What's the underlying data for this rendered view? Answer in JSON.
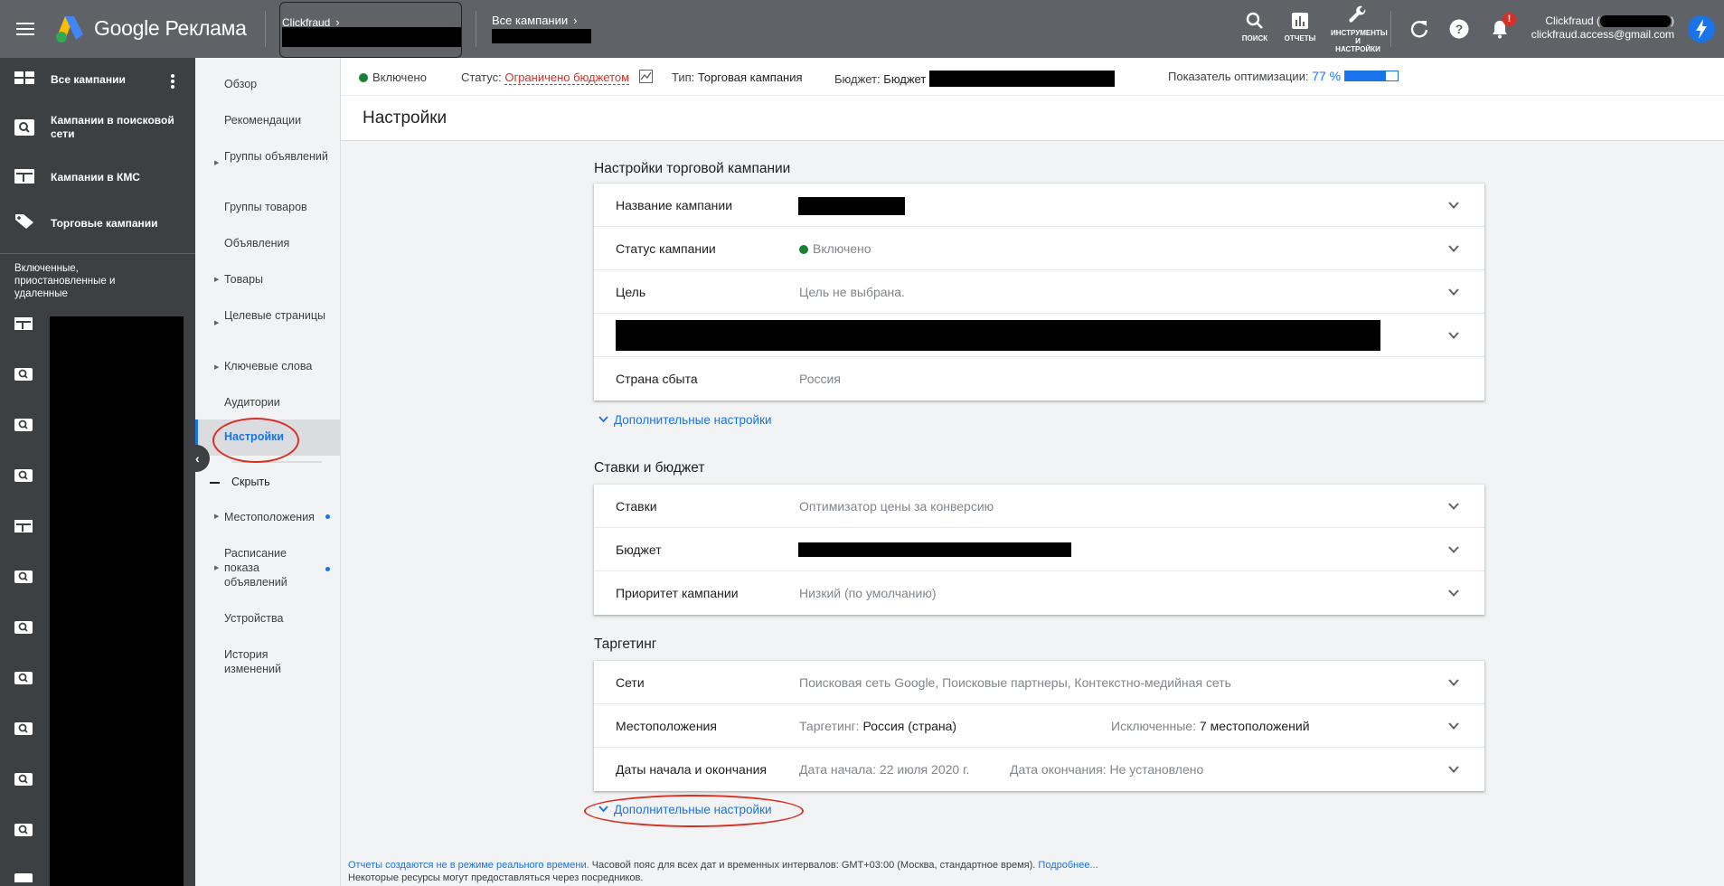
{
  "app": {
    "product_name": "Google Реклама"
  },
  "breadcrumb": {
    "account_label": "Clickfraud",
    "campaigns_label": "Все кампании"
  },
  "top_icons": [
    {
      "name": "search-icon",
      "label": "ПОИСК"
    },
    {
      "name": "reports-icon",
      "label": "ОТЧЕТЫ"
    },
    {
      "name": "tools-icon",
      "label_line1": "ИНСТРУМЕНТЫ",
      "label_line2": "И",
      "label_line3": "НАСТРОЙКИ"
    }
  ],
  "notifications": {
    "badge": "!"
  },
  "user": {
    "name_prefix": "Clickfraud (",
    "name_suffix": ")",
    "email": "clickfraud.access@gmail.com"
  },
  "leftnav": {
    "items": [
      {
        "label": "Все кампании",
        "icon": "dashboard-icon"
      },
      {
        "label": "Кампании в поисковой сети",
        "icon": "search-campaign-icon"
      },
      {
        "label": "Кампании в КМС",
        "icon": "display-campaign-icon"
      },
      {
        "label": "Торговые кампании",
        "icon": "shopping-tag-icon"
      }
    ],
    "filter_label": "Включенные, приостановленные и удаленные"
  },
  "subnav": {
    "items": [
      {
        "label": "Обзор"
      },
      {
        "label": "Рекомендации"
      },
      {
        "label": "Группы объявлений"
      },
      {
        "label": "Группы товаров"
      },
      {
        "label": "Объявления"
      },
      {
        "label": "Товары"
      },
      {
        "label": "Целевые страницы"
      },
      {
        "label": "Ключевые слова"
      },
      {
        "label": "Аудитории"
      },
      {
        "label": "Настройки"
      },
      {
        "label": "Скрыть"
      },
      {
        "label": "Местоположения"
      },
      {
        "label": "Расписание показа объявлений"
      },
      {
        "label": "Устройства"
      },
      {
        "label": "История изменений"
      }
    ]
  },
  "statusbar": {
    "enabled": "Включено",
    "status_label": "Статус:",
    "status_value": "Ограничено бюджетом",
    "type_label": "Тип:",
    "type_value": "Торговая кампания",
    "budget_label": "Бюджет:",
    "budget_value": "Бюджет",
    "opt_label": "Показатель оптимизации:",
    "opt_value": "77 %",
    "opt_fraction": 0.77
  },
  "page": {
    "title": "Настройки"
  },
  "sections": {
    "shopping": {
      "title": "Настройки торговой кампании",
      "rows": {
        "name": {
          "label": "Название кампании"
        },
        "status": {
          "label": "Статус кампании",
          "value": "Включено"
        },
        "goal": {
          "label": "Цель",
          "value": "Цель не выбрана."
        },
        "country": {
          "label": "Страна сбыта",
          "value": "Россия"
        }
      },
      "more": "Дополнительные настройки"
    },
    "bids": {
      "title": "Ставки и бюджет",
      "rows": {
        "bids": {
          "label": "Ставки",
          "value": "Оптимизатор цены за конверсию"
        },
        "budget": {
          "label": "Бюджет"
        },
        "priority": {
          "label": "Приоритет кампании",
          "value": "Низкий (по умолчанию)"
        }
      }
    },
    "targeting": {
      "title": "Таргетинг",
      "rows": {
        "networks": {
          "label": "Сети",
          "value": "Поисковая сеть Google, Поисковые партнеры, Контекстно-медийная сеть"
        },
        "locations": {
          "label": "Местоположения",
          "targeting_label": "Таргетинг:",
          "targeting_value": "Россия (страна)",
          "excluded_label": "Исключенные:",
          "excluded_value": "7 местоположений"
        },
        "dates": {
          "label": "Даты начала и окончания",
          "start": "Дата начала: 22 июля 2020 г.",
          "end_label": "Дата окончания:",
          "end_value": "Не установлено"
        }
      },
      "more": "Дополнительные настройки"
    }
  },
  "footer": {
    "line1_blue": "Отчеты создаются не в режиме реального времени.",
    "line1_text": "Часовой пояс для всех дат и временных интервалов: GMT+03:00 (Москва, стандартное время).",
    "line1_link": "Подробнее...",
    "line2": "Некоторые ресурсы могут предоставляться через посредников."
  },
  "colors": {
    "accent": "#1a73e8",
    "topbar": "#5f6368",
    "leftnav": "#3c4043",
    "enabled": "#188038",
    "warning": "#d93025"
  }
}
